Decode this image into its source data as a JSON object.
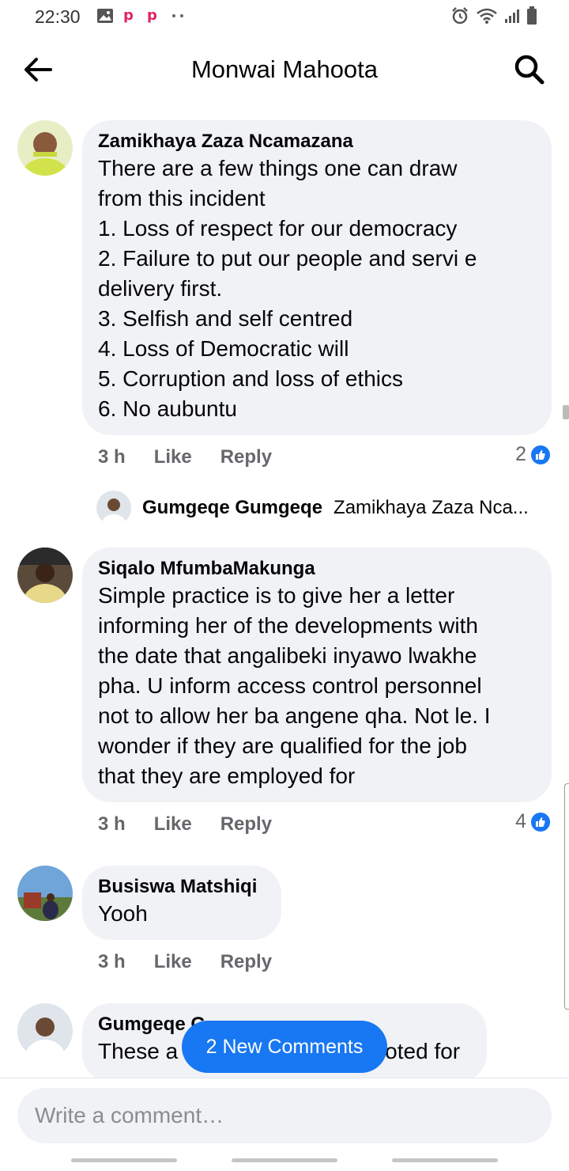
{
  "status": {
    "time": "22:30"
  },
  "header": {
    "title": "Monwai Mahoota"
  },
  "comments": [
    {
      "author": "Zamikhaya Zaza Ncamazana",
      "text": "There are a few things one can draw\nfrom this incident\n1. Loss of respect for our democracy\n2. Failure to put our people and servi e\ndelivery first.\n3. Selfish and self centred\n4. Loss of Democratic will\n5. Corruption and loss of ethics\n6. No aubuntu",
      "time": "3 h",
      "like": "Like",
      "reply": "Reply",
      "reactions": "2",
      "reply_preview": {
        "author": "Gumgeqe Gumgeqe",
        "text": "Zamikhaya Zaza Nca..."
      }
    },
    {
      "author": "Siqalo MfumbaMakunga",
      "text": "Simple practice is to give her a letter\ninforming her of the developments with\nthe date that angalibeki inyawo lwakhe\npha. U inform access control personnel\nnot to allow her ba angene qha. Not le. I\nwonder if they are qualified for the job\nthat they are employed for",
      "time": "3 h",
      "like": "Like",
      "reply": "Reply",
      "reactions": "4"
    },
    {
      "author": "Busiswa Matshiqi",
      "text": "Yooh",
      "time": "3 h",
      "like": "Like",
      "reply": "Reply"
    },
    {
      "author": "Gumgeqe G",
      "text": "These a",
      "text_tail": "oted for"
    }
  ],
  "new_comments_label": "2 New Comments",
  "composer": {
    "placeholder": "Write a comment…"
  },
  "colors": {
    "accent": "#1877f2",
    "bubble": "#f0f2f5",
    "meta": "#65676b"
  }
}
